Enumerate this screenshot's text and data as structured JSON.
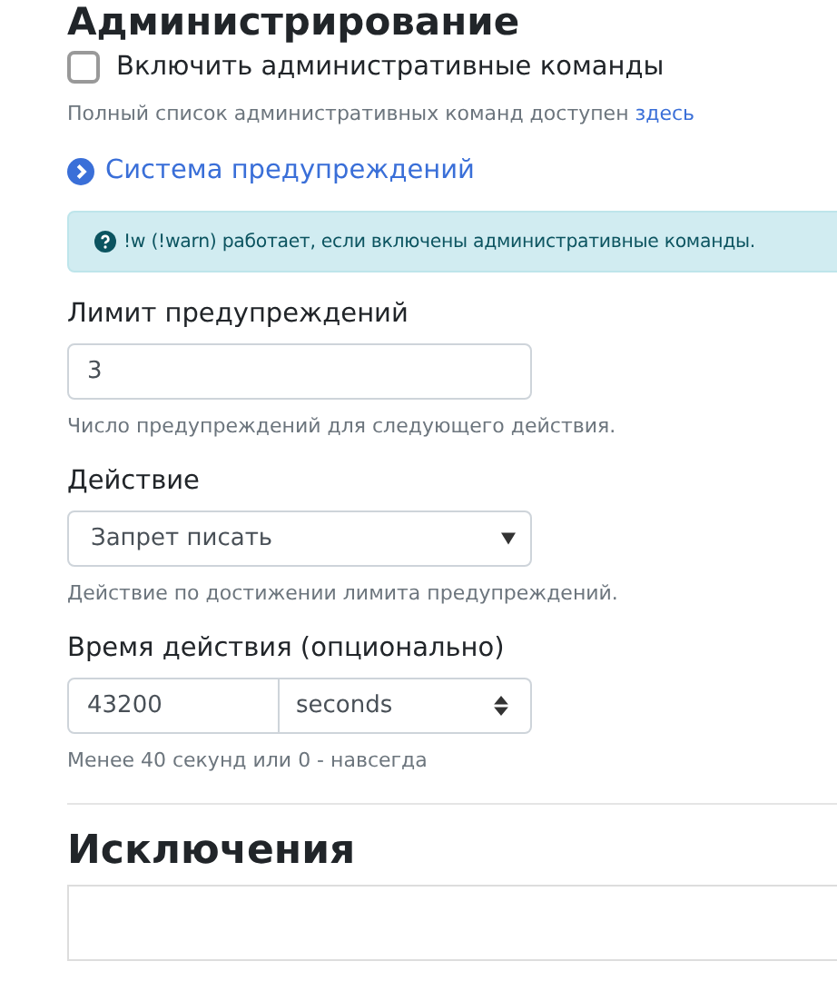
{
  "section_title": "Администрирование",
  "admin_commands": {
    "label": "Включить административные команды",
    "checked": false
  },
  "help": {
    "text": "Полный список административных команд доступен",
    "link": "здесь"
  },
  "warn_system": {
    "label": "Система предупреждений"
  },
  "alert": "!w (!warn) работает, если включены административные команды.",
  "fields": [
    {
      "kind": "input",
      "label": "Лимит предупреждений",
      "value": "3",
      "help": "Число предупреждений для следующего действия."
    },
    {
      "kind": "select",
      "label": "Действие",
      "value": "Запрет писать",
      "help": "Действие по достижении лимита предупреждений."
    },
    {
      "kind": "duration",
      "label": "Время действия (опционально)",
      "value": "43200",
      "unit": "seconds",
      "help": "Менее 40 секунд или 0 - навсегда"
    }
  ],
  "exceptions": {
    "title": "Исключения"
  }
}
